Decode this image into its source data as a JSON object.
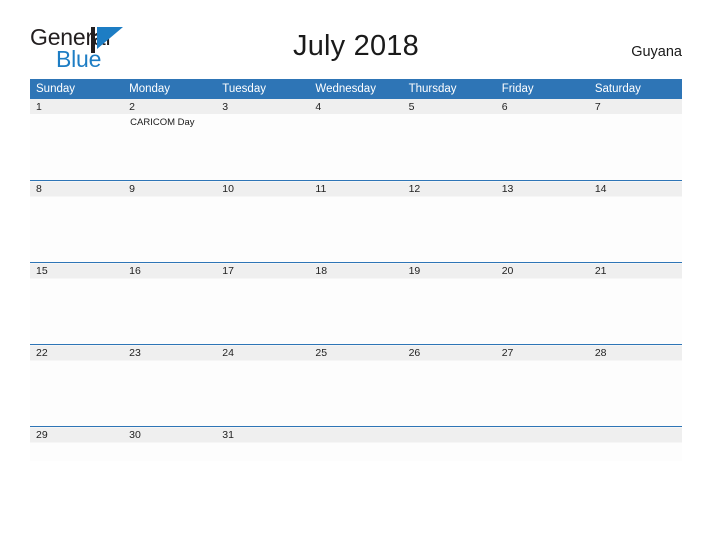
{
  "brand": {
    "word1": "General",
    "word2": "Blue",
    "mark_name": "blue-triangle-logo-mark",
    "accent_color": "#1d7dc4"
  },
  "header": {
    "title": "July 2018",
    "country": "Guyana"
  },
  "theme": {
    "header_blue": "#2e75b6",
    "row_band_gray": "#efefef",
    "cell_background": "#fdfdfd",
    "text_color": "#222222"
  },
  "calendar": {
    "weekday_headers": [
      "Sunday",
      "Monday",
      "Tuesday",
      "Wednesday",
      "Thursday",
      "Friday",
      "Saturday"
    ],
    "weeks": [
      {
        "days": [
          {
            "date": "1",
            "events": []
          },
          {
            "date": "2",
            "events": [
              "CARICOM Day"
            ]
          },
          {
            "date": "3",
            "events": []
          },
          {
            "date": "4",
            "events": []
          },
          {
            "date": "5",
            "events": []
          },
          {
            "date": "6",
            "events": []
          },
          {
            "date": "7",
            "events": []
          }
        ]
      },
      {
        "days": [
          {
            "date": "8",
            "events": []
          },
          {
            "date": "9",
            "events": []
          },
          {
            "date": "10",
            "events": []
          },
          {
            "date": "11",
            "events": []
          },
          {
            "date": "12",
            "events": []
          },
          {
            "date": "13",
            "events": []
          },
          {
            "date": "14",
            "events": []
          }
        ]
      },
      {
        "days": [
          {
            "date": "15",
            "events": []
          },
          {
            "date": "16",
            "events": []
          },
          {
            "date": "17",
            "events": []
          },
          {
            "date": "18",
            "events": []
          },
          {
            "date": "19",
            "events": []
          },
          {
            "date": "20",
            "events": []
          },
          {
            "date": "21",
            "events": []
          }
        ]
      },
      {
        "days": [
          {
            "date": "22",
            "events": []
          },
          {
            "date": "23",
            "events": []
          },
          {
            "date": "24",
            "events": []
          },
          {
            "date": "25",
            "events": []
          },
          {
            "date": "26",
            "events": []
          },
          {
            "date": "27",
            "events": []
          },
          {
            "date": "28",
            "events": []
          }
        ]
      },
      {
        "days": [
          {
            "date": "29",
            "events": []
          },
          {
            "date": "30",
            "events": []
          },
          {
            "date": "31",
            "events": []
          },
          {
            "date": "",
            "events": []
          },
          {
            "date": "",
            "events": []
          },
          {
            "date": "",
            "events": []
          },
          {
            "date": "",
            "events": []
          }
        ]
      }
    ]
  }
}
